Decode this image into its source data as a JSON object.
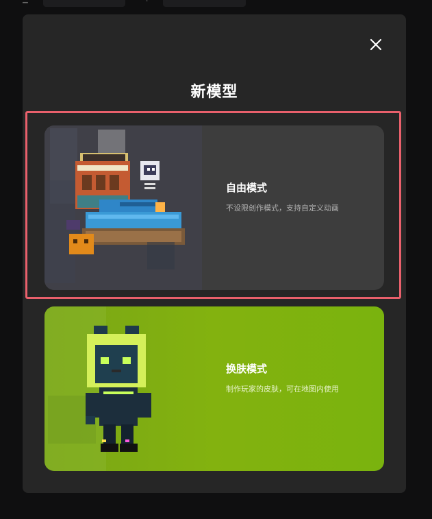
{
  "dialog": {
    "title": "新模型",
    "close_icon": "close-icon"
  },
  "cards": [
    {
      "name": "自由模式",
      "description": "不设限创作模式，支持自定义动画",
      "image_icon": "pixel-tank-cinema-illustration",
      "selected": true,
      "background": "#3d3d3d"
    },
    {
      "name": "换肤模式",
      "description": "制作玩家的皮肤，可在地图内使用",
      "image_icon": "pixel-cat-hood-character-illustration",
      "selected": false,
      "background": "#7db010"
    }
  ],
  "colors": {
    "modal_background": "#262626",
    "selection_border": "#e9606c",
    "title_text": "#ffffff"
  }
}
